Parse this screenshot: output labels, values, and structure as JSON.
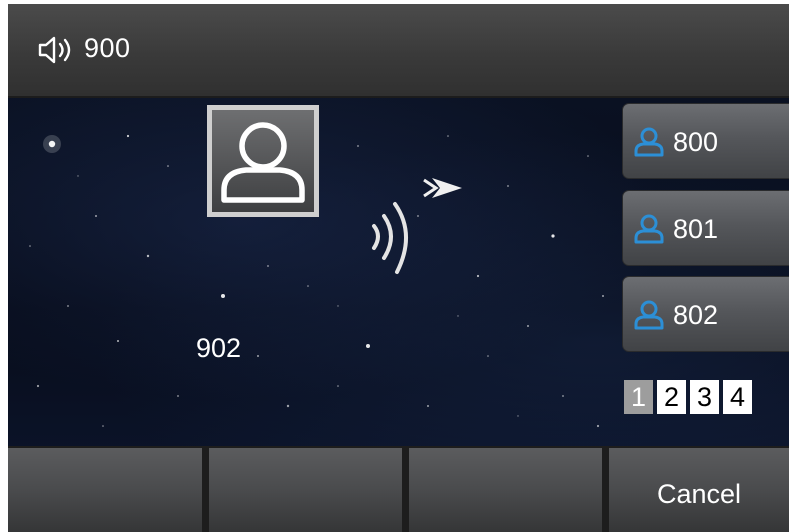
{
  "topbar": {
    "line_number": "900",
    "speaker_icon": "speaker-icon"
  },
  "call": {
    "avatar_icon": "contact-avatar-icon",
    "signal_icon": "sound-wave-icon",
    "direction_icon": "outgoing-arrow-icon",
    "callee_number": "902"
  },
  "line_keys": [
    {
      "label": "800",
      "icon": "person-icon"
    },
    {
      "label": "801",
      "icon": "person-icon"
    },
    {
      "label": "802",
      "icon": "person-icon"
    }
  ],
  "pager": {
    "pages": [
      "1",
      "2",
      "3",
      "4"
    ],
    "active_page": "1"
  },
  "softkeys": [
    "",
    "",
    "",
    "Cancel"
  ],
  "colors": {
    "accent": "#2c8fd6",
    "topbar": "#3f3f3f",
    "background": "#070d1a"
  }
}
